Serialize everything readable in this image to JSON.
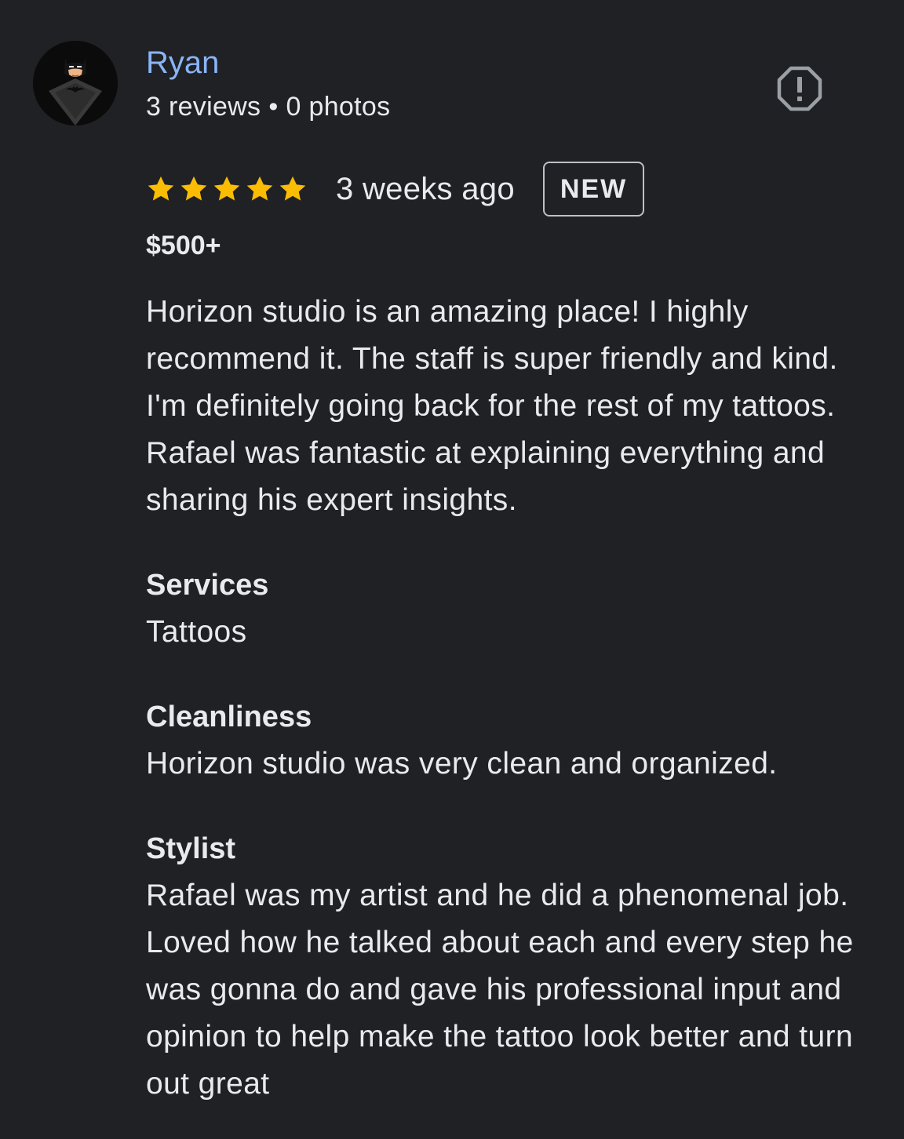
{
  "author": {
    "name": "Ryan",
    "reviews": "3 reviews",
    "separator": "•",
    "photos": "0 photos",
    "avatar_icon": "batman-avatar-icon"
  },
  "report_icon": "report-icon",
  "rating": {
    "stars": 5,
    "max_stars": 5,
    "star_color": "#fbbc04"
  },
  "review_date": "3 weeks ago",
  "badge": "NEW",
  "price": "$500+",
  "review_text": "Horizon studio is an amazing place! I highly recommend it. The staff is super friendly and kind. I'm definitely going back for the rest of my tattoos. Rafael was fantastic at explaining everything and sharing his expert insights.",
  "sections": {
    "services": {
      "label": "Services",
      "value": "Tattoos"
    },
    "cleanliness": {
      "label": "Cleanliness",
      "value": "Horizon studio was very clean and organized."
    },
    "stylist": {
      "label": "Stylist",
      "value": "Rafael was my artist and he did a phenomenal job. Loved how he talked about each and every step he was gonna do and gave his professional input and opinion to help make the tattoo look better and turn out great"
    }
  },
  "colors": {
    "background": "#202124",
    "author_name": "#8ab4f8",
    "text": "#e8eaed"
  }
}
